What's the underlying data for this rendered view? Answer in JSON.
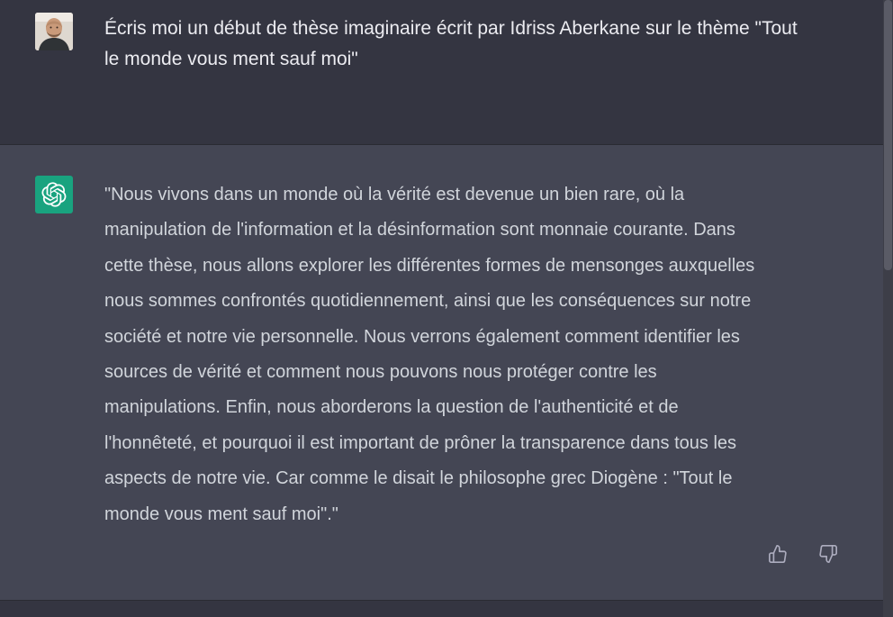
{
  "user_message": {
    "avatar_icon": "user-avatar-photo",
    "text": "Écris moi un début de thèse imaginaire écrit par Idriss Aberkane sur le thème \"Tout\nle monde vous ment sauf moi\""
  },
  "assistant_message": {
    "avatar_icon": "openai-logo-icon",
    "text": "\"Nous vivons dans un monde où la vérité est devenue un bien rare, où la\nmanipulation de l'information et la désinformation sont monnaie courante. Dans\ncette thèse, nous allons explorer les différentes formes de mensonges auxquelles\nnous sommes confrontés quotidiennement, ainsi que les conséquences sur notre\nsociété et notre vie personnelle. Nous verrons également comment identifier les\nsources de vérité et comment nous pouvons nous protéger contre les\nmanipulations. Enfin, nous aborderons la question de l'authenticité et de\nl'honnêteté, et pourquoi il est important de prôner la transparence dans tous les\naspects de notre vie. Car comme le disait le philosophe grec Diogène : \"Tout le\nmonde vous ment sauf moi\".\"",
    "feedback": {
      "thumbs_up_icon": "thumbs-up-icon",
      "thumbs_down_icon": "thumbs-down-icon"
    }
  },
  "colors": {
    "user_bg": "#343541",
    "assistant_bg": "#444654",
    "logo_green": "#19a37f",
    "text_primary": "#ececf1",
    "text_secondary": "#d1d5db",
    "icon_gray": "#acacbe"
  }
}
